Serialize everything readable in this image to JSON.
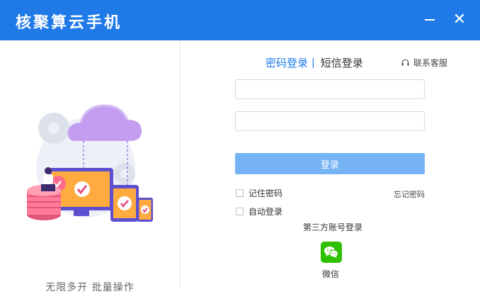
{
  "window": {
    "title": "核聚算云手机",
    "minimize_icon": "minimize-icon",
    "close_icon": "close-icon",
    "close_glyph": "✕"
  },
  "left": {
    "slogan": "无限多开 批量操作"
  },
  "tabs": {
    "password_login": "密码登录",
    "separator": "|",
    "sms_login": "短信登录"
  },
  "support": {
    "label": "联系客服",
    "icon": "headset-icon"
  },
  "form": {
    "username_value": "",
    "password_value": "",
    "login_button": "登录",
    "remember_password": "记住密码",
    "auto_login": "自动登录",
    "forgot_password": "忘记密码"
  },
  "third_party": {
    "title": "第三方账号登录",
    "wechat_label": "微信",
    "wechat_icon": "wechat-icon"
  },
  "colors": {
    "accent": "#1f7ae8",
    "login_button": "#76b3f5",
    "wechat": "#2dc100"
  }
}
